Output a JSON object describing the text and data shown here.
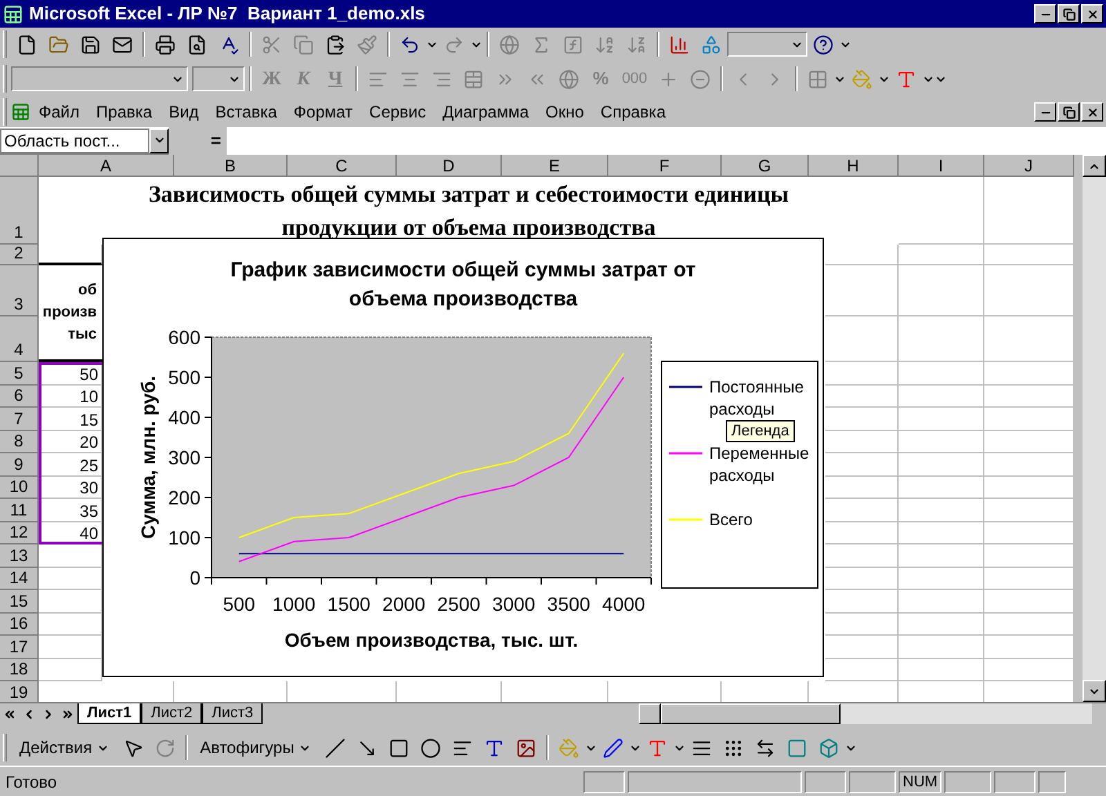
{
  "window": {
    "title": "Microsoft Excel - ЛР №7  Вариант 1_demo.xls"
  },
  "formatting_toolbar": {
    "style_buttons": [
      "Ж",
      "К",
      "Ч"
    ],
    "percent": "%",
    "thousands": "000"
  },
  "menu": [
    "Файл",
    "Правка",
    "Вид",
    "Вставка",
    "Формат",
    "Сервис",
    "Диаграмма",
    "Окно",
    "Справка"
  ],
  "formula_bar": {
    "name_box": "Область пост...",
    "equals": "="
  },
  "sheet": {
    "columns": [
      "A",
      "B",
      "C",
      "D",
      "E",
      "F",
      "G",
      "H",
      "I",
      "J"
    ],
    "row_numbers": [
      "1",
      "2",
      "3",
      "4",
      "5",
      "6",
      "7",
      "8",
      "9",
      "10",
      "11",
      "12",
      "13",
      "14",
      "15",
      "16",
      "17",
      "18",
      "19"
    ],
    "title_lines": [
      "Зависимость общей суммы затрат и себестоимости единицы",
      "продукции от объема производства"
    ],
    "header_lines": [
      "об",
      "произв",
      "тыс"
    ],
    "values": [
      "50",
      "10",
      "15",
      "20",
      "25",
      "30",
      "35",
      "40"
    ]
  },
  "chart": {
    "chart_data": {
      "type": "line",
      "title": "График зависимости общей суммы затрат от объема производства",
      "xlabel": "Объем производства, тыс. шт.",
      "ylabel": "Сумма, млн. руб.",
      "categories": [
        "500",
        "1000",
        "1500",
        "2000",
        "2500",
        "3000",
        "3500",
        "4000"
      ],
      "series": [
        {
          "name": "Постоянные расходы",
          "color": "#000080",
          "values": [
            60,
            60,
            60,
            60,
            60,
            60,
            60,
            60
          ]
        },
        {
          "name": "Переменные расходы",
          "color": "#ff00ff",
          "values": [
            40,
            90,
            100,
            150,
            200,
            230,
            300,
            500
          ]
        },
        {
          "name": "Всего",
          "color": "#ffff00",
          "values": [
            100,
            150,
            160,
            210,
            260,
            290,
            360,
            560
          ]
        }
      ],
      "legend": "right",
      "ylim": [
        0,
        600
      ],
      "yticks": [
        0,
        100,
        200,
        300,
        400,
        500,
        600
      ]
    },
    "tooltip": "Легенда"
  },
  "sheet_tabs": [
    {
      "label": "Лист1",
      "selected": true
    },
    {
      "label": "Лист2",
      "selected": false
    },
    {
      "label": "Лист3",
      "selected": false
    }
  ],
  "drawing_toolbar": {
    "actions": "Действия",
    "autoshapes": "Автофигуры"
  },
  "status_bar": {
    "text": "Готово",
    "indicators": [
      "NUM"
    ]
  }
}
